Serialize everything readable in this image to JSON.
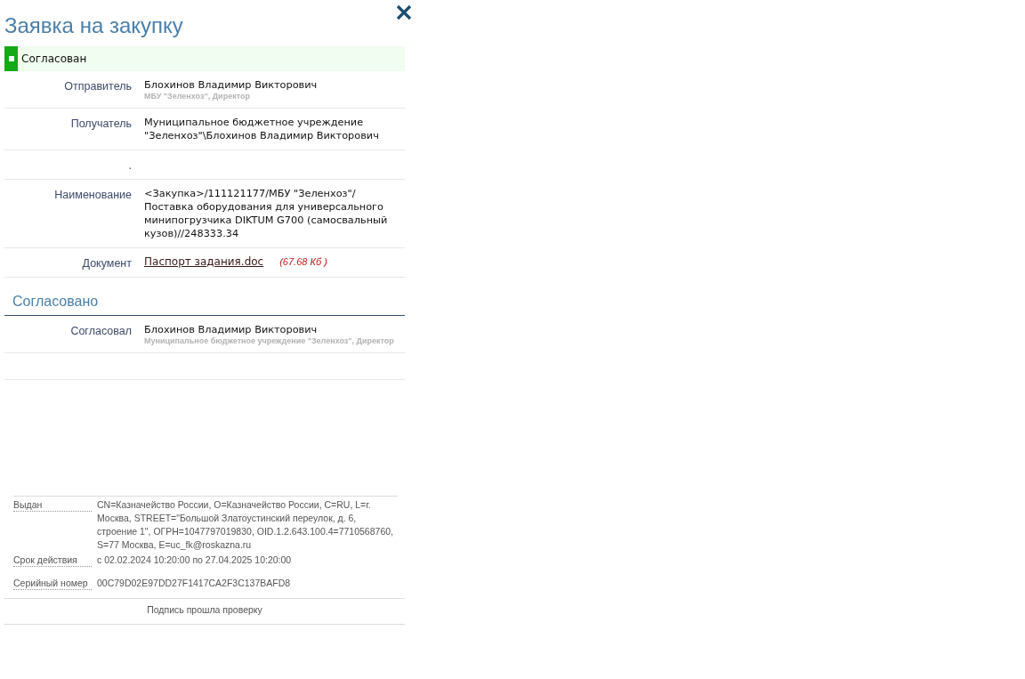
{
  "title": "Заявка на закупку",
  "status": {
    "label": "Согласован"
  },
  "fields": [
    {
      "label": "Отправитель",
      "value": "Блохинов Владимир Викторович",
      "note": "МБУ \"Зеленхоз\", Директор"
    },
    {
      "label": "Получатель",
      "value": "Муниципальное бюджетное учреждение \"Зеленхоз\"\\Блохинов Владимир Викторович"
    },
    {
      "label": "."
    },
    {
      "label": "Наименование",
      "value": "<Закупка>/111121177/МБУ \"Зеленхоз\"/ Поставка оборудования для универсального минипогрузчика DIKTUM G700 (самосвальный кузов)//248333.34"
    },
    {
      "label": "Документ",
      "link": "Паспорт задания.doc",
      "size": "(67.68 Кб )"
    }
  ],
  "approved": {
    "heading": "Согласовано",
    "rows": [
      {
        "label": "Согласовал",
        "value": "Блохинов Владимир Викторович",
        "note": "Муниципальное бюджетное учреждение \"Зеленхоз\", Директор"
      }
    ]
  },
  "certificate": {
    "rows": [
      {
        "label": "Выдан",
        "value": "CN=Казначейство России, O=Казначейство России, C=RU, L=г. Москва, STREET=\"Большой Златоустинский переулок, д. 6, строение 1\", ОГРН=1047797019830, OID.1.2.643.100.4=7710568760, S=77 Москва, E=uc_fk@roskazna.ru"
      },
      {
        "label": "Срок действия",
        "value": "с 02.02.2024 10:20:00 по 27.04.2025 10:20:00"
      },
      {
        "label": "Серийный номер",
        "value": "00C79D02E97DD27F1417CA2F3C137BAFD8"
      }
    ],
    "result": "Подпись прошла проверку"
  }
}
